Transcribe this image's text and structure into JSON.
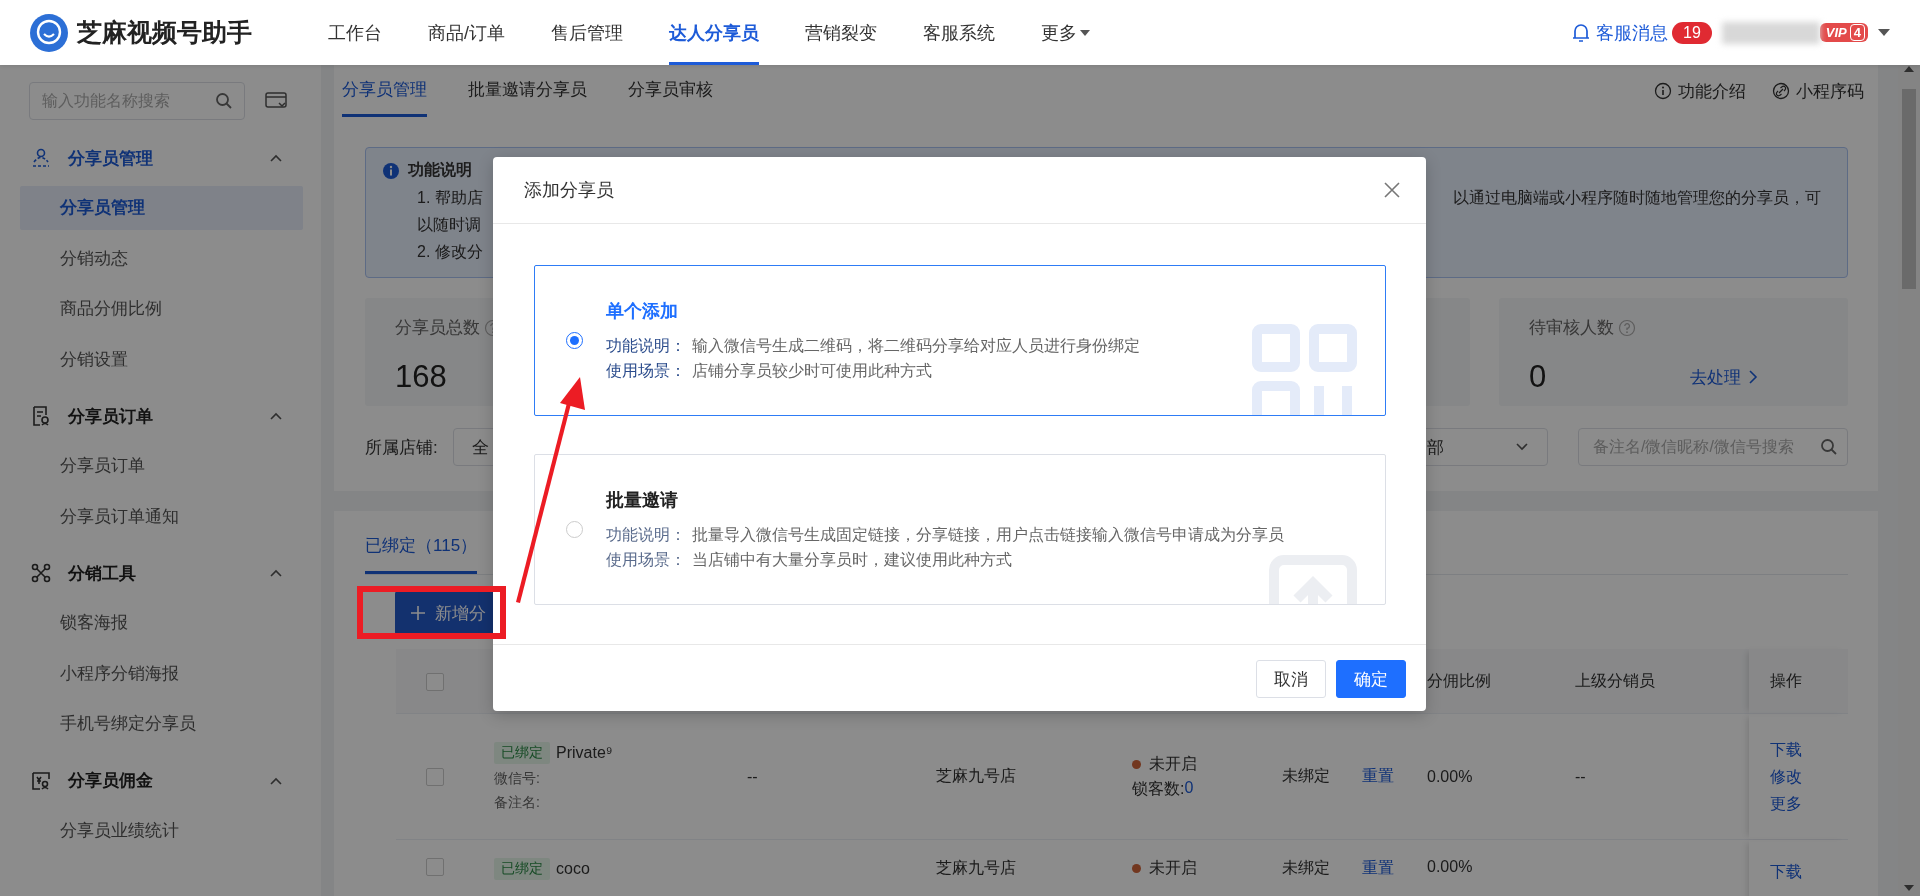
{
  "app": {
    "name": "芝麻视频号助手"
  },
  "nav": [
    {
      "label": "工作台",
      "selected": false,
      "has_menu": false
    },
    {
      "label": "商品/订单",
      "selected": false,
      "has_menu": false
    },
    {
      "label": "售后管理",
      "selected": false,
      "has_menu": false
    },
    {
      "label": "达人分享员",
      "selected": true,
      "has_menu": false
    },
    {
      "label": "营销裂变",
      "selected": false,
      "has_menu": false
    },
    {
      "label": "客服系统",
      "selected": false,
      "has_menu": false
    },
    {
      "label": "更多",
      "selected": false,
      "has_menu": true
    }
  ],
  "messages": {
    "label": "客服消息",
    "count": "19"
  },
  "account": {
    "vip": "VIP",
    "level": "4"
  },
  "sidebar": {
    "search": {
      "placeholder": "输入功能名称搜索"
    },
    "groups": [
      {
        "title": "分享员管理",
        "expanded": true,
        "items": [
          {
            "label": "分享员管理",
            "selected": true
          },
          {
            "label": "分销动态",
            "selected": false
          },
          {
            "label": "商品分佣比例",
            "selected": false
          },
          {
            "label": "分销设置",
            "selected": false
          }
        ]
      },
      {
        "title": "分享员订单",
        "expanded": true,
        "items": [
          {
            "label": "分享员订单",
            "selected": false
          },
          {
            "label": "分享员订单通知",
            "selected": false
          }
        ]
      },
      {
        "title": "分销工具",
        "expanded": true,
        "items": [
          {
            "label": "锁客海报",
            "selected": false
          },
          {
            "label": "小程序分销海报",
            "selected": false
          },
          {
            "label": "手机号绑定分享员",
            "selected": false
          }
        ]
      },
      {
        "title": "分享员佣金",
        "expanded": true,
        "items": [
          {
            "label": "分享员业绩统计",
            "selected": false
          }
        ]
      }
    ]
  },
  "subtabs": [
    {
      "label": "分享员管理",
      "selected": true
    },
    {
      "label": "批量邀请分享员",
      "selected": false
    },
    {
      "label": "分享员审核",
      "selected": false
    }
  ],
  "help_links": [
    {
      "label": "功能介绍",
      "kind": "info"
    },
    {
      "label": "小程序码",
      "kind": "link"
    }
  ],
  "notice": {
    "title": "功能说明",
    "lines": [
      {
        "left": "1. 帮助店",
        "right": "以通过电脑端或小程序随时随地管理您的分享员，可"
      },
      {
        "left": "以随时调"
      },
      {
        "left": "2. 修改分"
      }
    ]
  },
  "stats": [
    {
      "label": "分享员总数",
      "value": "168"
    },
    {
      "label": "待审核人数",
      "value": "0",
      "action": "去处理"
    }
  ],
  "filters": {
    "store_label": "所属店铺:",
    "store_value": "全",
    "select_value": "部",
    "search_placeholder": "备注名/微信昵称/微信号搜索"
  },
  "list_tabs": [
    {
      "label": "已绑定（115）",
      "selected": true
    }
  ],
  "add_button": {
    "label": "新增分"
  },
  "table": {
    "select_all": {
      "checked": false
    },
    "columns": [
      "分佣比例",
      "上级分销员",
      "操作"
    ],
    "rows": [
      {
        "checked": false,
        "status_tag": "已绑定",
        "name": "Private⁹",
        "wechat_label": "微信号:",
        "remark_label": "备注名:",
        "column_2": "--",
        "store": "芝麻九号店",
        "lock": "未开启",
        "lock_count_label": "锁客数:",
        "lock_count": "0",
        "bind": "未绑定",
        "reset": "重置",
        "ratio": "0.00%",
        "parent": "--",
        "actions": [
          "下载",
          "修改",
          "更多"
        ]
      },
      {
        "checked": false,
        "status_tag": "已绑定",
        "name": "coco",
        "store": "芝麻九号店",
        "lock": "未开启",
        "bind": "未绑定",
        "reset": "重置",
        "ratio": "0.00%",
        "actions": [
          "下载"
        ]
      }
    ]
  },
  "dialog": {
    "title": "添加分享员",
    "options": [
      {
        "title": "单个添加",
        "selected": true,
        "kind": "qr",
        "lines": [
          {
            "label": "功能说明：",
            "text": "输入微信号生成二维码，将二维码分享给对应人员进行身份绑定"
          },
          {
            "label": "使用场景：",
            "text": "店铺分享员较少时可使用此种方式"
          }
        ]
      },
      {
        "title": "批量邀请",
        "selected": false,
        "kind": "upload",
        "lines": [
          {
            "label": "功能说明：",
            "text": "批量导入微信号生成固定链接，分享链接，用户点击链接输入微信号申请成为分享员"
          },
          {
            "label": "使用场景：",
            "text": "当店铺中有大量分享员时，建议使用此种方式"
          }
        ]
      }
    ],
    "buttons": [
      {
        "label": "取消",
        "kind": "secondary"
      },
      {
        "label": "确定",
        "kind": "primary"
      }
    ]
  }
}
